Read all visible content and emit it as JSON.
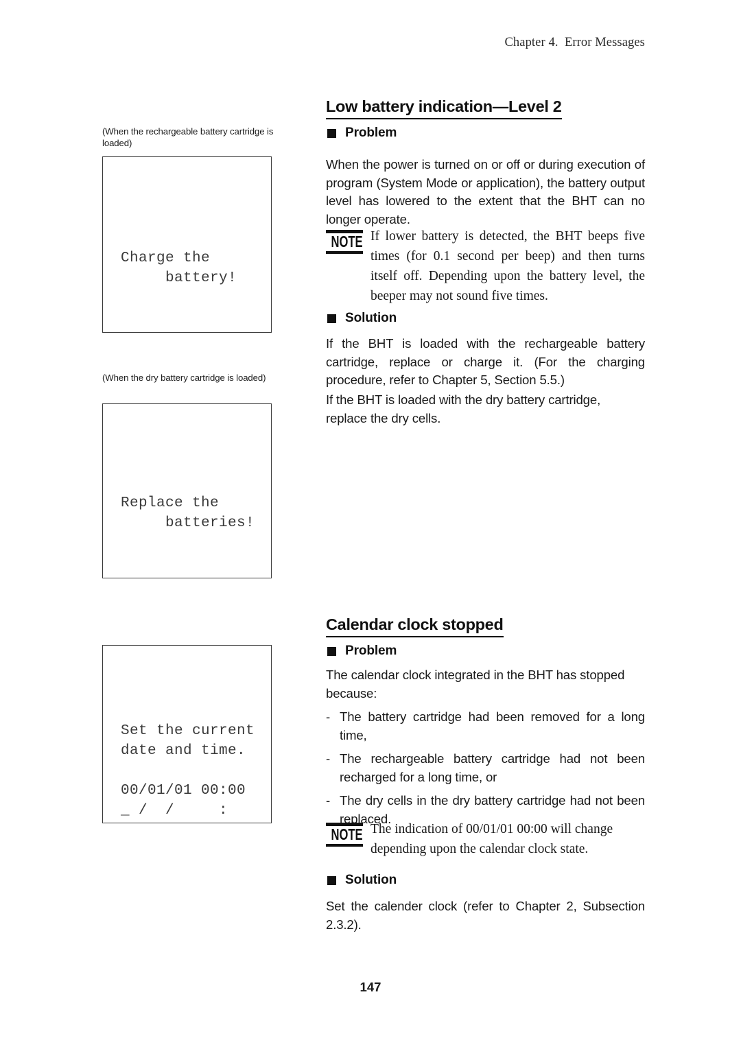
{
  "header": {
    "running_head": "Chapter 4.  Error Messages"
  },
  "page_footer": {
    "page_number": "147"
  },
  "left_column": {
    "lcd_panels": [
      {
        "caption": "(When the rechargeable battery cartridge is loaded)",
        "screen_text": "Charge the\n     battery!"
      },
      {
        "caption": "(When the dry battery cartridge is loaded)",
        "screen_text": "Replace the\n     batteries!"
      },
      {
        "caption": "",
        "screen_text": "Set the current\ndate and time.\n\n00/01/01 00:00\n_ /  /     :"
      }
    ]
  },
  "sections": [
    {
      "title": "Low battery indication—Level 2",
      "problem_label": "Problem",
      "problem_text": "When the power is turned on or off or during execution of program (System Mode or application), the battery output level has lowered to the extent that the BHT can no longer operate.",
      "note_icon_label": "NOTE",
      "note_text": "If lower battery is detected, the BHT beeps five times (for 0.1 second per beep) and then turns itself off.  Depending upon the battery level, the beeper may not sound five times.",
      "solution_label": "Solution",
      "solution_paragraphs": [
        "If the BHT is loaded with the rechargeable battery cartridge, replace or charge it.  (For the charging procedure, refer to Chapter 5, Section 5.5.)",
        "If the BHT is loaded with the dry battery cartridge, replace the dry cells."
      ]
    },
    {
      "title": "Calendar clock stopped",
      "problem_label": "Problem",
      "problem_text": "The calendar clock integrated in the BHT has stopped because:",
      "causes_marker": "-",
      "causes": [
        "The battery cartridge had been removed for a long time,",
        "The rechargeable battery cartridge had not been recharged for a long time, or",
        "The dry cells in the dry battery cartridge had not been replaced."
      ],
      "note_icon_label": "NOTE",
      "note_text": "The indication of 00/01/01 00:00 will change depending upon the calendar clock state.",
      "solution_label": "Solution",
      "solution_paragraphs": [
        "Set the calender clock (refer to Chapter 2, Subsection 2.3.2)."
      ]
    }
  ],
  "colors": {
    "ink": "#1a1a1a",
    "rule": "#111111",
    "lcd_border": "#3a3a3a",
    "lcd_text": "#3a3a3a"
  }
}
